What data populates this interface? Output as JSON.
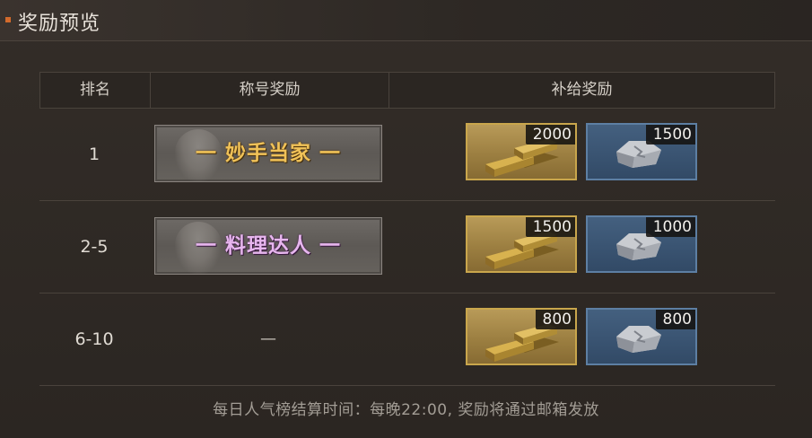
{
  "header": {
    "title": "奖励预览"
  },
  "table": {
    "columns": [
      "排名",
      "称号奖励",
      "补给奖励"
    ],
    "rows": [
      {
        "rank": "1",
        "title_reward": "一 妙手当家 一",
        "title_style": "gold",
        "items": [
          {
            "icon": "gold-bars-icon",
            "qty": "2000"
          },
          {
            "icon": "silver-ore-icon",
            "qty": "1500"
          }
        ]
      },
      {
        "rank": "2-5",
        "title_reward": "一 料理达人 一",
        "title_style": "purple",
        "items": [
          {
            "icon": "gold-bars-icon",
            "qty": "1500"
          },
          {
            "icon": "silver-ore-icon",
            "qty": "1000"
          }
        ]
      },
      {
        "rank": "6-10",
        "title_reward": "—",
        "title_style": "none",
        "items": [
          {
            "icon": "gold-bars-icon",
            "qty": "800"
          },
          {
            "icon": "silver-ore-icon",
            "qty": "800"
          }
        ]
      }
    ]
  },
  "footer": {
    "note": "每日人气榜结算时间：每晚22:00, 奖励将通过邮箱发放"
  },
  "colors": {
    "accent": "#d26a2c",
    "gold_border": "#c9a64c",
    "silver_border": "#5d7fa3",
    "badge_gold_text": "#f0c258",
    "badge_purple_text": "#e7b6ee"
  }
}
